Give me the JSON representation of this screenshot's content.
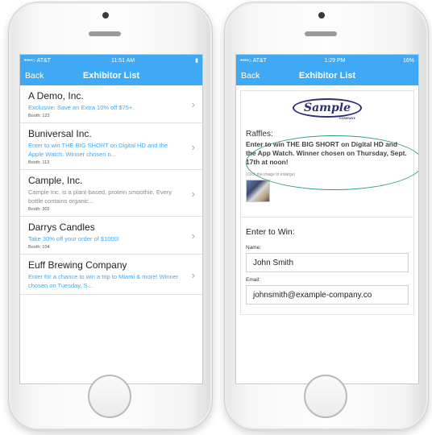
{
  "left_screen": {
    "status": {
      "carrier": "••••○ AT&T",
      "time": "11:51 AM",
      "battery": "▮"
    },
    "nav": {
      "back": "Back",
      "title": "Exhibitor List"
    },
    "items": [
      {
        "name": "A Demo, Inc.",
        "desc": "Exclusive: Save an Extra 10% off $75+.",
        "booth": "Booth: 123"
      },
      {
        "name": "Buniversal Inc.",
        "desc": "Enter to win THE BIG SHORT on Digital HD and the Apple Watch. Winner chosen o...",
        "booth": "Booth: 113"
      },
      {
        "name": "Cample, Inc.",
        "desc": "Cample Inc. is a plant-based, protein smoothie. Every bottle contains organic...",
        "booth": "Booth: 302"
      },
      {
        "name": "Darrys Candles",
        "desc": "Take 30% off your order of $1000!",
        "booth": "Booth: 104"
      },
      {
        "name": "Euff Brewing Company",
        "desc": "Enter for a chance to win a trip to Miami & more! Winner chosen on Tuesday, S...",
        "booth": ""
      }
    ]
  },
  "right_screen": {
    "status": {
      "carrier": "••••○ AT&T",
      "time": "1:29 PM",
      "battery": "16%"
    },
    "nav": {
      "back": "Back",
      "title": "Exhibitor List"
    },
    "logo": {
      "text": "Sample",
      "sub": "COMPANY"
    },
    "raffles": {
      "label": "Raffles:",
      "text": "Enter to win THE BIG SHORT on Digital HD and the App Watch. Winner chosen on Thursday, Sept. 17th at noon!",
      "hint": "(Click the image to enlarge)"
    },
    "form": {
      "title": "Enter to Win:",
      "name_label": "Name:",
      "name_value": "John Smith",
      "email_label": "Email:",
      "email_value": "johnsmith@example-company.co"
    }
  },
  "colors": {
    "accent": "#3fa9f5",
    "oval": "#2aa06f"
  }
}
